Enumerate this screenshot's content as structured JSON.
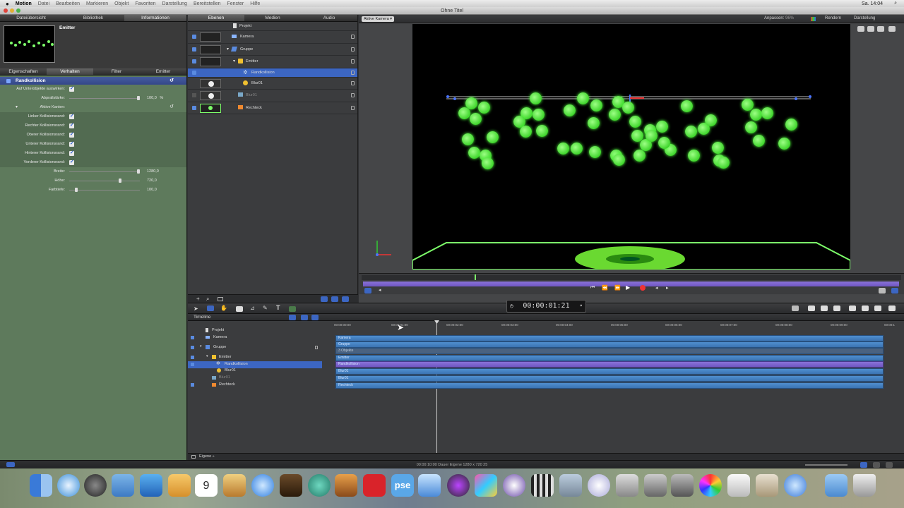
{
  "menubar": {
    "apple": "",
    "items": [
      "Motion",
      "Datei",
      "Bearbeiten",
      "Markieren",
      "Objekt",
      "Favoriten",
      "Darstellung",
      "Bereitstellen",
      "Fenster",
      "Hilfe"
    ],
    "clock": "Sa. 14:04"
  },
  "window": {
    "title": "Ohne Titel"
  },
  "inspector": {
    "top_tabs": [
      "Dateiübersicht",
      "Bibliothek",
      "Informationen"
    ],
    "preview_name": "Emitter",
    "sub_tabs": [
      "Eigenschaften",
      "Verhalten",
      "Filter",
      "Emitter"
    ],
    "behavior_title": "Randkollision",
    "params": {
      "affect_subobjects": "Auf Unterobjekte auswirken:",
      "bounce_label": "Abprallstärke:",
      "bounce_value": "100,0",
      "bounce_unit": "%",
      "bounce_level": 1.0,
      "active_edges": "Aktive Kanten:",
      "edges": [
        "Linker Kollisionsrand:",
        "Rechter Kollisionsrand:",
        "Oberer Kollisionsrand:",
        "Unterer Kollisionsrand:",
        "Hinterer Kollisionsrand:",
        "Vorderer Kollisionsrand:"
      ],
      "width_label": "Breite:",
      "width_value": "1280,0",
      "width_level": 1.0,
      "height_label": "Höhe:",
      "height_value": "720,0",
      "height_level": 0.72,
      "depth_label": "Farbtiefe:",
      "depth_value": "100,0",
      "depth_level": 0.1
    }
  },
  "layers": {
    "tabs": [
      "Ebenen",
      "Medien",
      "Audio"
    ],
    "rows": [
      {
        "name": "Projekt"
      },
      {
        "name": "Kamera"
      },
      {
        "name": "Gruppe"
      },
      {
        "name": "Emitter"
      },
      {
        "name": "Randkollision"
      },
      {
        "name": "Blur01"
      },
      {
        "name": "Blur01"
      },
      {
        "name": "Rechteck"
      }
    ]
  },
  "canvas": {
    "camera_menu": "Aktive Kamera",
    "fit_label": "Anpassen:",
    "fit_value": "96%",
    "render_menu": "Rendern",
    "view_menu": "Darstellung",
    "playhead": 0.21
  },
  "transport": {
    "timecode": "00:00:01:21"
  },
  "timeline": {
    "title": "Timeline",
    "ruler": [
      "00:00:00:00",
      "00:00:01:00",
      "00:00:02:00",
      "00:00:03:00",
      "00:00:04:00",
      "00:00:05:00",
      "00:00:06:00",
      "00:00:07:00",
      "00:00:08:00",
      "00:00:09:00",
      "00:00:1"
    ],
    "rows": [
      {
        "name": "Projekt",
        "bar": ""
      },
      {
        "name": "Kamera",
        "bar": "Kamera"
      },
      {
        "name": "Gruppe",
        "bar": "Gruppe"
      },
      {
        "name": "",
        "bar": "3 Objekte"
      },
      {
        "name": "Emitter",
        "bar": "Emitter"
      },
      {
        "name": "Randkollision",
        "bar": "Randkollision"
      },
      {
        "name": "Blur01",
        "bar": "Blur01"
      },
      {
        "name": "Blur01",
        "bar": "Blur01"
      },
      {
        "name": "Rechteck",
        "bar": "Rechteck"
      }
    ],
    "footer_menu": "Eigene"
  },
  "status": {
    "text": "00:00:10:00 Dauer Eigene 1280 x 720 25"
  },
  "colors": {
    "accent": "#3c66c2",
    "inspector_bg": "#5e7a5c",
    "particle": "#4dff3a",
    "behavior_bar": "#7a60cc"
  }
}
